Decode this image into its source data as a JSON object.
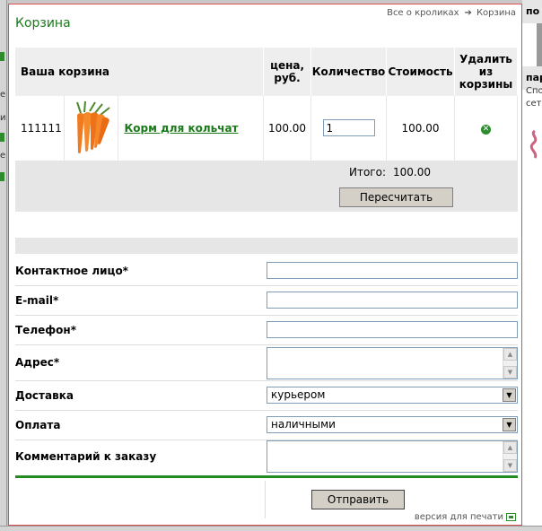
{
  "background": {
    "right_headers": [
      "по",
      "пар"
    ],
    "right_text": [
      "Спо",
      "сет"
    ],
    "left_text": [
      "е",
      "и",
      "е"
    ]
  },
  "popup": {
    "title": "Корзина",
    "breadcrumb": {
      "link": "Все о кроликах",
      "current": "Корзина"
    }
  },
  "cart": {
    "headers": {
      "name": "Ваша корзина",
      "price": "цена, руб.",
      "qty": "Количество",
      "cost": "Стоимость",
      "remove": "Удалить из корзины"
    },
    "items": [
      {
        "id": "111111",
        "name": "Корм для кольчат",
        "price": "100.00",
        "qty": "1",
        "cost": "100.00"
      }
    ],
    "total_label": "Итого:",
    "total_value": "100.00",
    "recalc_label": "Пересчитать"
  },
  "form": {
    "contact_label": "Контактное лицо*",
    "email_label": "E-mail*",
    "phone_label": "Телефон*",
    "address_label": "Адрес*",
    "delivery_label": "Доставка",
    "delivery_value": "курьером",
    "payment_label": "Оплата",
    "payment_value": "наличными",
    "comment_label": "Комментарий к заказу",
    "submit_label": "Отправить",
    "print_label": "версия для печати"
  },
  "colors": {
    "accent": "#1a7a1a",
    "border": "#d85050"
  }
}
